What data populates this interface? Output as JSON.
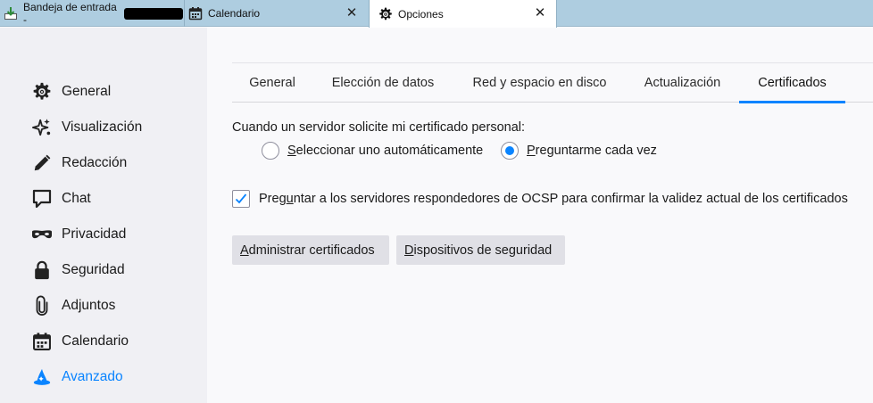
{
  "tabs": {
    "inbox": {
      "label": "Bandeja de entrada -"
    },
    "calendar": {
      "label": "Calendario"
    },
    "options": {
      "label": "Opciones"
    }
  },
  "sidebar": {
    "items": [
      {
        "label": "General",
        "icon": "gear-icon"
      },
      {
        "label": "Visualización",
        "icon": "sparkle-icon"
      },
      {
        "label": "Redacción",
        "icon": "pencil-icon"
      },
      {
        "label": "Chat",
        "icon": "chat-bubble-icon"
      },
      {
        "label": "Privacidad",
        "icon": "mask-icon"
      },
      {
        "label": "Seguridad",
        "icon": "lock-icon"
      },
      {
        "label": "Adjuntos",
        "icon": "paperclip-icon"
      },
      {
        "label": "Calendario",
        "icon": "calendar-icon"
      },
      {
        "label": "Avanzado",
        "icon": "wizard-hat-icon",
        "selected": true
      }
    ]
  },
  "prefs_tabs": [
    {
      "label": "General"
    },
    {
      "label": "Elección de datos"
    },
    {
      "label": "Red y espacio en disco"
    },
    {
      "label": "Actualización"
    },
    {
      "label": "Certificados",
      "selected": true
    }
  ],
  "certificates": {
    "prompt": "Cuando un servidor solicite mi certificado personal:",
    "radio_auto": {
      "pre": "",
      "key": "S",
      "post": "eleccionar uno automáticamente",
      "checked": false
    },
    "radio_ask": {
      "pre": "",
      "key": "P",
      "post": "reguntarme cada vez",
      "checked": true
    },
    "ocsp": {
      "pre": "Preg",
      "key": "u",
      "post": "ntar a los servidores respondedores de OCSP para confirmar la validez actual de los certificados",
      "checked": true
    },
    "manage_button": {
      "pre": "",
      "key": "A",
      "post": "dministrar certificados"
    },
    "devices_button": {
      "pre": "",
      "key": "D",
      "post": "ispositivos de seguridad"
    }
  },
  "colors": {
    "accent": "#0a84ff",
    "tabstrip": "#aecde0",
    "sidebar": "#f0f0f4"
  }
}
